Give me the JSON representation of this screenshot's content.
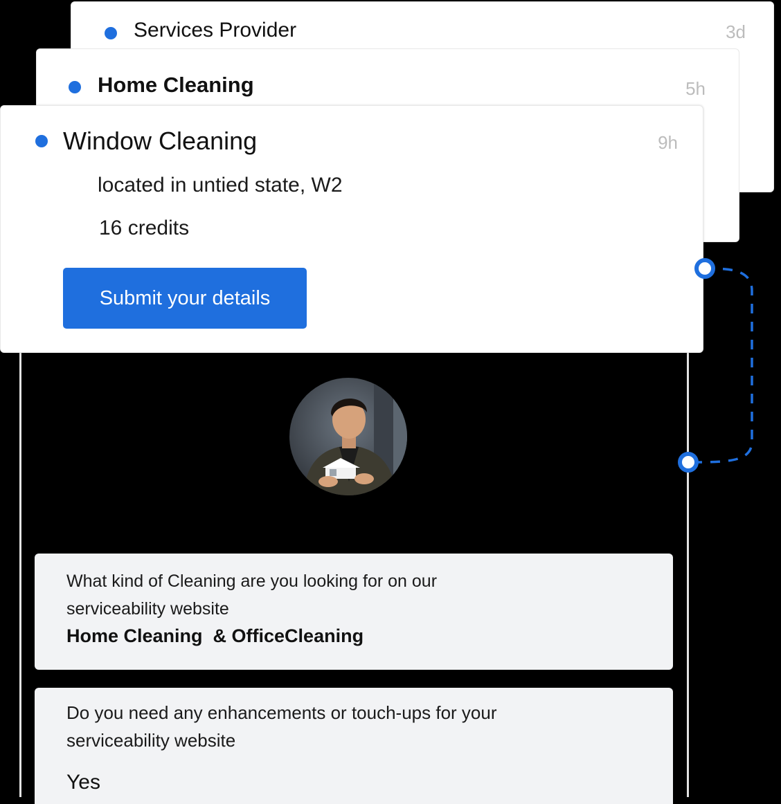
{
  "cards": {
    "back": {
      "title": "Services Provider",
      "time": "3d"
    },
    "middle": {
      "title": "Home Cleaning",
      "time": "5h"
    },
    "front": {
      "title": "Window Cleaning",
      "time": "9h",
      "location": "located in untied state, W2",
      "credits": "16 credits",
      "button_label": "Submit your details"
    }
  },
  "questions": [
    {
      "question_line1": "What kind of Cleaning are you looking for on our",
      "question_line2": "serviceability website",
      "answer": "Home Cleaning  & OfficeCleaning"
    },
    {
      "question_line1": "Do you need any enhancements or touch-ups for your",
      "question_line2": "serviceability website",
      "answer": "Yes"
    }
  ],
  "colors": {
    "accent": "#1f6fde",
    "background": "#000000",
    "card": "#ffffff",
    "question_box": "#f2f3f5",
    "time_text": "#bcbcbc"
  },
  "icons": {
    "status_dot": "bullet-dot-icon",
    "connector": "dashed-connector-icon",
    "avatar": "user-avatar"
  }
}
